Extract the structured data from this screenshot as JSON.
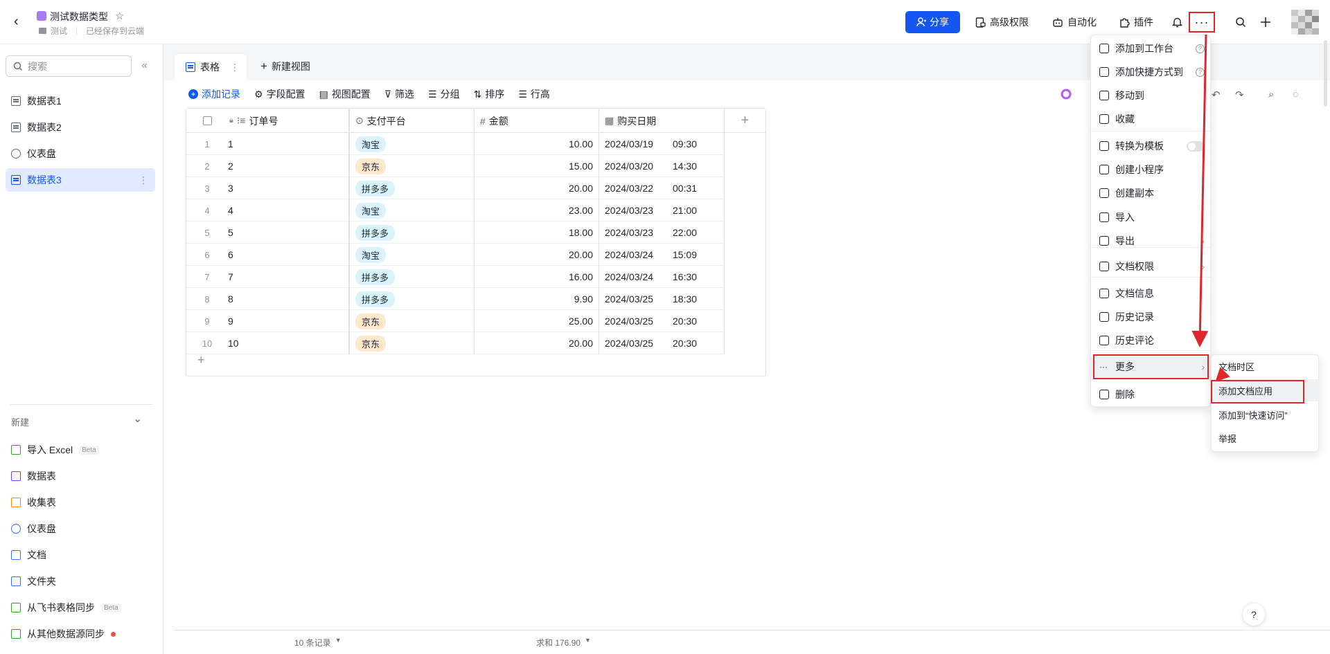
{
  "header": {
    "doc_title": "测试数据类型",
    "breadcrumb_folder": "测试",
    "save_status": "已经保存到云端",
    "share_label": "分享",
    "advanced_permission_label": "高级权限",
    "automation_label": "自动化",
    "plugin_label": "插件",
    "more_label": "···"
  },
  "sidebar": {
    "search_placeholder": "搜索",
    "items": [
      {
        "label": "数据表1",
        "icon": "table-icon"
      },
      {
        "label": "数据表2",
        "icon": "table-icon"
      },
      {
        "label": "仪表盘",
        "icon": "dashboard-icon"
      },
      {
        "label": "数据表3",
        "icon": "table-icon",
        "active": true
      }
    ],
    "new_section_label": "新建",
    "new_items": [
      {
        "label": "导入 Excel",
        "badge": "Beta",
        "color": "#2ea121"
      },
      {
        "label": "数据表",
        "color": "#7f3bf5"
      },
      {
        "label": "收集表",
        "color": "#ff8800"
      },
      {
        "label": "仪表盘",
        "color": "#3370ff"
      },
      {
        "label": "文档",
        "color": "#3370ff"
      },
      {
        "label": "文件夹",
        "color": "#3370ff"
      },
      {
        "label": "从飞书表格同步",
        "badge": "Beta",
        "color": "#2ea121"
      },
      {
        "label": "从其他数据源同步",
        "color": "#2ea121"
      }
    ]
  },
  "tabs": {
    "active_label": "表格",
    "new_view_label": "新建视图"
  },
  "toolbar": {
    "add_record": "添加记录",
    "field_config": "字段配置",
    "view_config": "视图配置",
    "filter": "筛选",
    "group": "分组",
    "sort": "排序",
    "row_height": "行高"
  },
  "table": {
    "columns": [
      "订单号",
      "支付平台",
      "金额",
      "购买日期"
    ],
    "rows": [
      {
        "n": "1",
        "id": "1",
        "platform": "淘宝",
        "amount": "10.00",
        "date": "2024/03/19",
        "time": "09:30"
      },
      {
        "n": "2",
        "id": "2",
        "platform": "京东",
        "amount": "15.00",
        "date": "2024/03/20",
        "time": "14:30"
      },
      {
        "n": "3",
        "id": "3",
        "platform": "拼多多",
        "amount": "20.00",
        "date": "2024/03/22",
        "time": "00:31"
      },
      {
        "n": "4",
        "id": "4",
        "platform": "淘宝",
        "amount": "23.00",
        "date": "2024/03/23",
        "time": "21:00"
      },
      {
        "n": "5",
        "id": "5",
        "platform": "拼多多",
        "amount": "18.00",
        "date": "2024/03/23",
        "time": "22:00"
      },
      {
        "n": "6",
        "id": "6",
        "platform": "淘宝",
        "amount": "20.00",
        "date": "2024/03/24",
        "time": "15:09"
      },
      {
        "n": "7",
        "id": "7",
        "platform": "拼多多",
        "amount": "16.00",
        "date": "2024/03/24",
        "time": "16:30"
      },
      {
        "n": "8",
        "id": "8",
        "platform": "拼多多",
        "amount": "9.90",
        "date": "2024/03/25",
        "time": "18:30"
      },
      {
        "n": "9",
        "id": "9",
        "platform": "京东",
        "amount": "25.00",
        "date": "2024/03/25",
        "time": "20:30"
      },
      {
        "n": "10",
        "id": "10",
        "platform": "京东",
        "amount": "20.00",
        "date": "2024/03/25",
        "time": "20:30"
      }
    ],
    "tag_colors": {
      "淘宝": "#d9f3fd",
      "京东": "#fee7cd",
      "拼多多": "#d9f3fd"
    }
  },
  "footer": {
    "record_count": "10 条记录",
    "sum_label": "求和 176.90"
  },
  "menu": {
    "items": [
      {
        "label": "添加到工作台",
        "suffix": "help"
      },
      {
        "label": "添加快捷方式到",
        "suffix": "help"
      },
      {
        "label": "移动到"
      },
      {
        "label": "收藏"
      },
      {
        "label": "转换为模板",
        "suffix": "toggle"
      },
      {
        "label": "创建小程序"
      },
      {
        "label": "创建副本"
      },
      {
        "label": "导入"
      },
      {
        "label": "导出",
        "suffix": "chevron"
      },
      {
        "label": "文档权限",
        "suffix": "chevron"
      },
      {
        "label": "文档信息"
      },
      {
        "label": "历史记录"
      },
      {
        "label": "历史评论"
      },
      {
        "label": "更多",
        "suffix": "chevron"
      },
      {
        "label": "删除"
      }
    ],
    "submenu": [
      "文档时区",
      "添加文档应用",
      "添加到“快速访问”",
      "举报"
    ]
  },
  "colors": {
    "accent": "#1456f0",
    "highlight": "#e0262d"
  }
}
